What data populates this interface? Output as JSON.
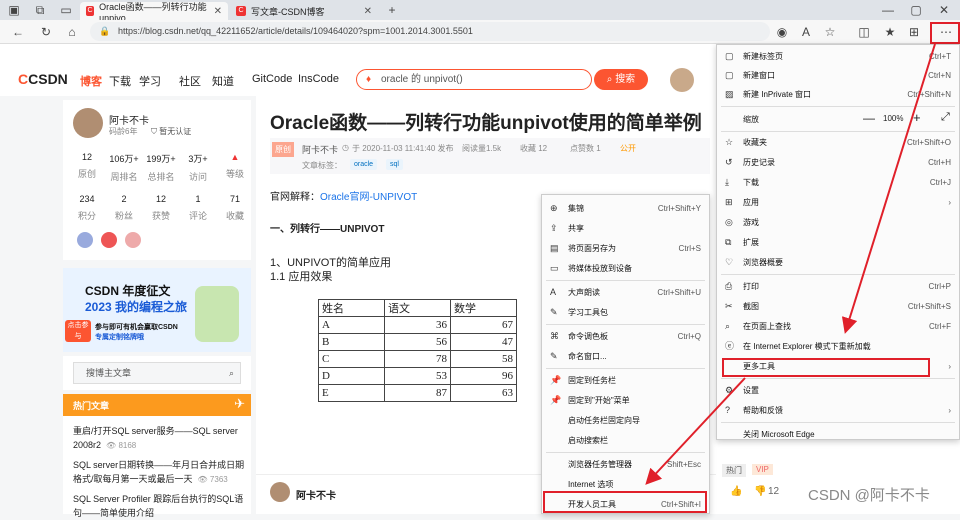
{
  "tabs": [
    {
      "title": "Oracle函数——列转行功能unpivo",
      "active": true
    },
    {
      "title": "写文章-CSDN博客",
      "active": false
    }
  ],
  "new_tab_icon": "plus-icon",
  "address": {
    "url": "https://blog.csdn.net/qq_42211652/article/details/109464020?spm=1001.2014.3001.5501"
  },
  "csdn_nav": {
    "logo_prefix": "C",
    "logo_text": "CSDN",
    "items": [
      "博客",
      "下载",
      "学习",
      "社区",
      "知道",
      "GitCode",
      "InsCode"
    ],
    "search_placeholder": "oracle 的 unpivot()",
    "search_button": "搜索"
  },
  "author": {
    "name": "阿卡不卡",
    "level": "码龄6年",
    "auth": "暂无认证",
    "stats1": [
      {
        "v": "12",
        "l": "原创"
      },
      {
        "v": "106万+",
        "l": "周排名"
      },
      {
        "v": "199万+",
        "l": "总排名"
      },
      {
        "v": "3万+",
        "l": "访问"
      },
      {
        "v": "",
        "l": "等级"
      }
    ],
    "stats2": [
      {
        "v": "234",
        "l": "积分"
      },
      {
        "v": "2",
        "l": "粉丝"
      },
      {
        "v": "12",
        "l": "获赞"
      },
      {
        "v": "1",
        "l": "评论"
      },
      {
        "v": "71",
        "l": "收藏"
      }
    ]
  },
  "banner": {
    "line1": "CSDN 年度征文",
    "line2": "2023 我的编程之旅",
    "line3": "参与即可有机会赢取CSDN",
    "line4": "专属定制铭牌哦",
    "badge": "点击参与"
  },
  "side_search": "搜博主文章",
  "hot": {
    "title": "热门文章",
    "items": [
      {
        "t1": "重启/打开SQL server服务——SQL server",
        "t2": "2008r2",
        "v": "8168"
      },
      {
        "t1": "SQL server日期转换——年月日合并成日期",
        "t2": "格式/取每月第一天或最后一天",
        "v": "7363"
      },
      {
        "t1": "SQL Server Profiler 跟踪后台执行的SQL语",
        "t2": "句——简单使用介绍",
        "v": ""
      }
    ]
  },
  "article": {
    "title": "Oracle函数——列转行功能unpivot使用的简单举例",
    "badge": "原创",
    "author": "阿卡不卡",
    "date": "于 2020-11-03 11:41:40 发布",
    "reads": "阅读量1.5k",
    "fav": "收藏 12",
    "likes": "点赞数 1",
    "license": "公开",
    "tag_label": "文章标签：",
    "tags": [
      "oracle",
      "sql"
    ],
    "ref_label": "官网解释：",
    "ref_link": "Oracle官网-UNPIVOT",
    "h_sec": "一、列转行——UNPIVOT",
    "p1": "1、UNPIVOT的简单应用",
    "p2": "1.1 应用效果",
    "table_header": [
      "姓名",
      "语文",
      "数学"
    ],
    "table_rows": [
      [
        "A",
        "36",
        "67"
      ],
      [
        "B",
        "56",
        "47"
      ],
      [
        "C",
        "78",
        "58"
      ],
      [
        "D",
        "53",
        "96"
      ],
      [
        "E",
        "87",
        "63"
      ]
    ],
    "bottom_author": "阿卡不卡"
  },
  "more_tools_menu": [
    {
      "label": "集锦",
      "sc": "Ctrl+Shift+Y"
    },
    {
      "label": "共享",
      "sc": ""
    },
    {
      "label": "将页面另存为",
      "sc": "Ctrl+S"
    },
    {
      "label": "将媒体投放到设备",
      "sc": ""
    },
    {
      "label": "大声朗读",
      "sc": "Ctrl+Shift+U"
    },
    {
      "label": "学习工具包",
      "sc": ""
    },
    {
      "label": "命令调色板",
      "sc": "Ctrl+Q"
    },
    {
      "label": "命名窗口...",
      "sc": ""
    },
    {
      "label": "固定到任务栏",
      "sc": ""
    },
    {
      "label": "固定到\"开始\"菜单",
      "sc": ""
    },
    {
      "label": "启动任务栏固定向导",
      "sc": ""
    },
    {
      "label": "启动搜索栏",
      "sc": ""
    },
    {
      "label": "浏览器任务管理器",
      "sc": "Shift+Esc"
    },
    {
      "label": "Internet 选项",
      "sc": ""
    },
    {
      "label": "开发人员工具",
      "sc": "Ctrl+Shift+I"
    }
  ],
  "edge_menu": [
    {
      "label": "新建标签页",
      "sc": "Ctrl+T"
    },
    {
      "label": "新建窗口",
      "sc": "Ctrl+N"
    },
    {
      "label": "新建 InPrivate 窗口",
      "sc": "Ctrl+Shift+N"
    },
    {
      "label": "收藏夹",
      "sc": "Ctrl+Shift+O"
    },
    {
      "label": "历史记录",
      "sc": "Ctrl+H"
    },
    {
      "label": "下载",
      "sc": "Ctrl+J"
    },
    {
      "label": "应用",
      "sc": ""
    },
    {
      "label": "游戏",
      "sc": ""
    },
    {
      "label": "扩展",
      "sc": ""
    },
    {
      "label": "浏览器概要",
      "sc": ""
    },
    {
      "label": "打印",
      "sc": "Ctrl+P"
    },
    {
      "label": "截图",
      "sc": "Ctrl+Shift+S"
    },
    {
      "label": "在页面上查找",
      "sc": "Ctrl+F"
    },
    {
      "label": "在 Internet Explorer 模式下重新加载",
      "sc": ""
    },
    {
      "label": "更多工具",
      "sc": ""
    },
    {
      "label": "设置",
      "sc": ""
    },
    {
      "label": "帮助和反馈",
      "sc": ""
    },
    {
      "label": "关闭 Microsoft Edge",
      "sc": ""
    }
  ],
  "zoom": {
    "label": "缩放",
    "value": "100%"
  },
  "bottom_right": {
    "hot_tag": "热门",
    "vip": "VIP",
    "likes": "12",
    "watermark": "CSDN @阿卡不卡"
  },
  "colors": {
    "accent": "#fc5531",
    "red_box": "#e0202a"
  }
}
